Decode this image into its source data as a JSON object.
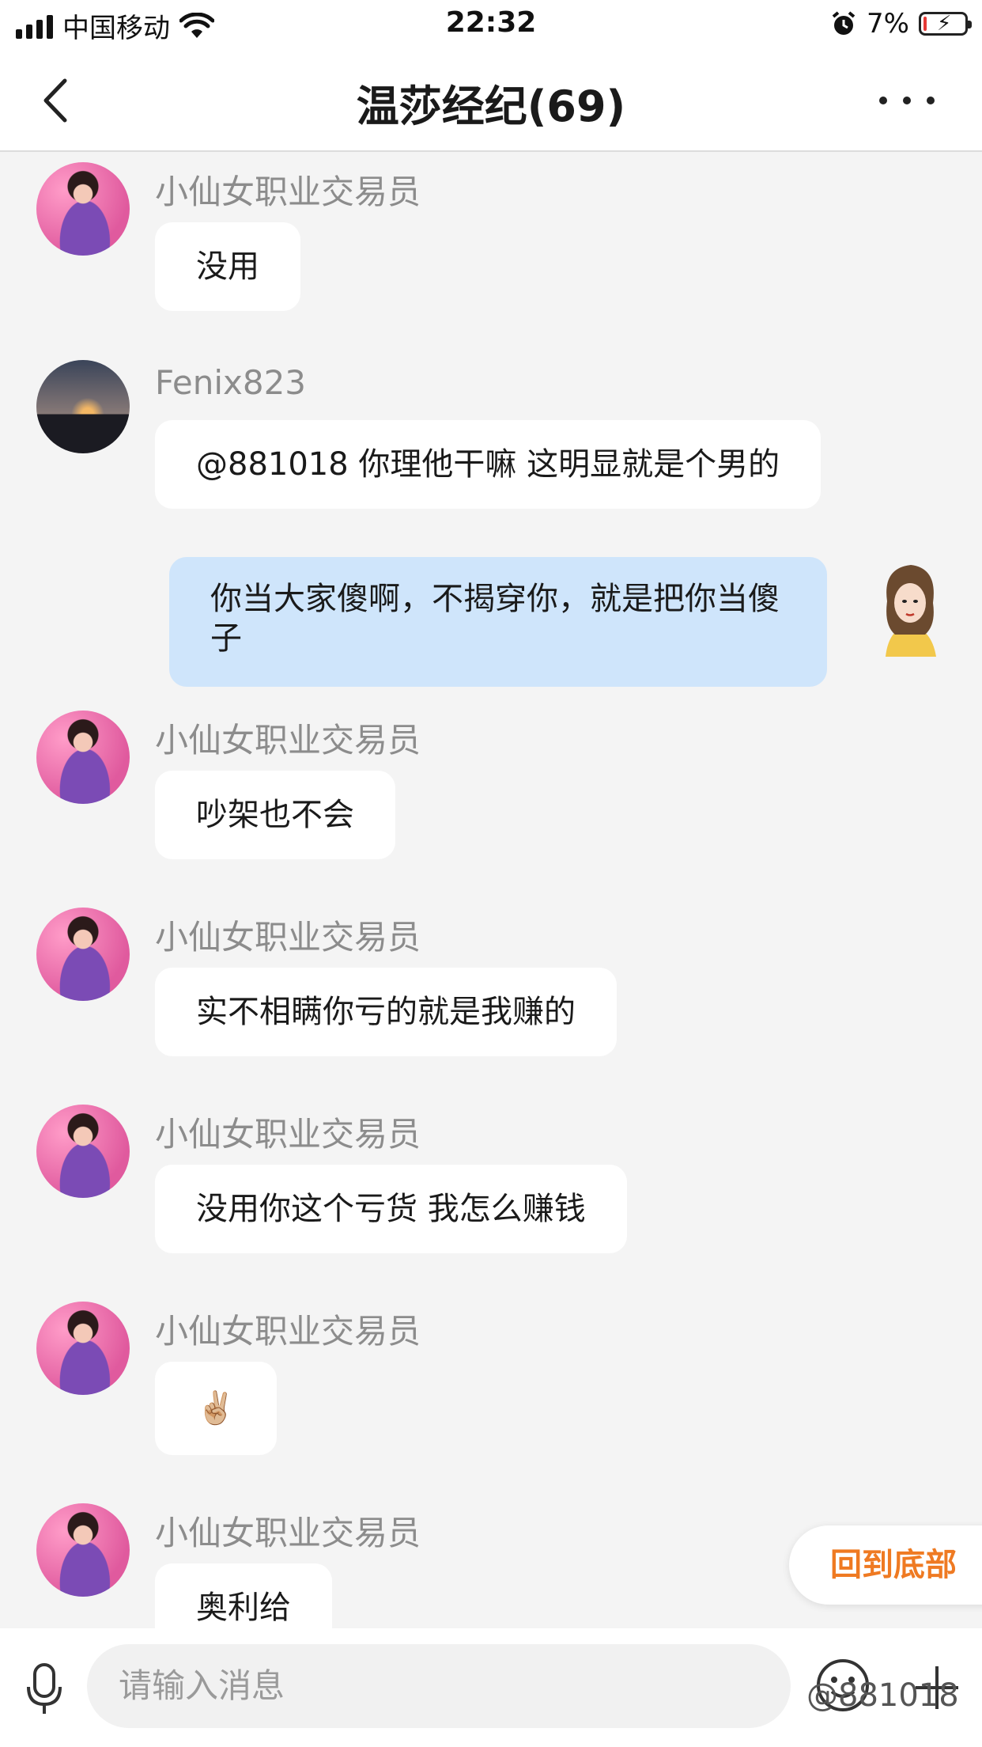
{
  "status_bar": {
    "carrier": "中国移动",
    "time": "22:32",
    "battery_percent": "7%",
    "battery_level": 0.07
  },
  "nav": {
    "title": "温莎经纪(69)"
  },
  "messages": [
    {
      "sender": "小仙女职业交易员",
      "text": "没用",
      "avatar": "avatar-girl"
    },
    {
      "sender": "Fenix823",
      "text": "@881018 你理他干嘛 这明显就是个男的",
      "avatar": "avatar-city"
    },
    {
      "sender": "",
      "text": "你当大家傻啊，不揭穿你，就是把你当傻子",
      "self": true
    },
    {
      "sender": "小仙女职业交易员",
      "text": "吵架也不会",
      "avatar": "avatar-girl"
    },
    {
      "sender": "小仙女职业交易员",
      "text": "实不相瞒你亏的就是我赚的",
      "avatar": "avatar-girl"
    },
    {
      "sender": "小仙女职业交易员",
      "text": "没用你这个亏货 我怎么赚钱",
      "avatar": "avatar-girl"
    },
    {
      "sender": "小仙女职业交易员",
      "text": "✌🏼",
      "avatar": "avatar-girl"
    },
    {
      "sender": "小仙女职业交易员",
      "text": "奥利给",
      "avatar": "avatar-girl"
    }
  ],
  "back_to_bottom": "回到底部",
  "input": {
    "placeholder": "请输入消息"
  },
  "watermark": "@881018",
  "colors": {
    "accent_orange": "#ef7a22",
    "self_bubble": "#cfe5fb",
    "background": "#f4f4f4"
  }
}
